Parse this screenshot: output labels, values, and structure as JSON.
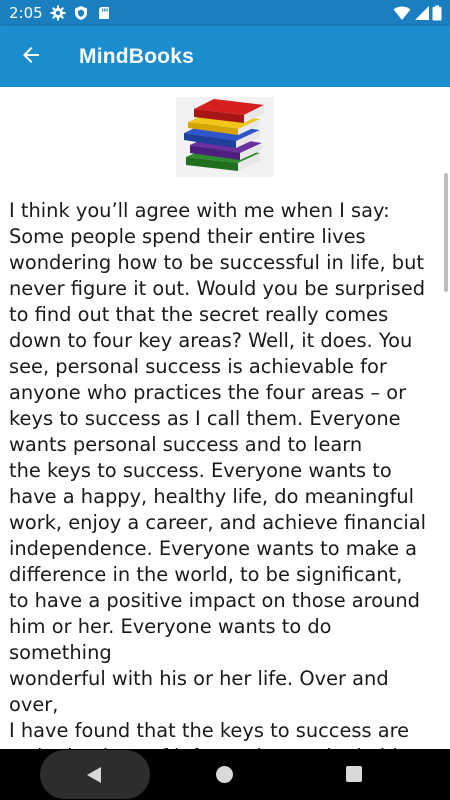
{
  "status_bar": {
    "time": "2:05",
    "left_icons": [
      "gear-icon",
      "shield-icon",
      "sd-card-icon"
    ],
    "right_icons": [
      "wifi-icon",
      "cellular-signal-icon",
      "battery-icon"
    ]
  },
  "app_bar": {
    "back_icon": "arrow-back-icon",
    "title": "MindBooks",
    "color": "#1b8ccd"
  },
  "content": {
    "image": "stack-of-books",
    "text": "I think you’ll agree with me when I say:\nSome people spend their entire lives\nwondering how to be successful in life, but\nnever figure it out. Would you be surprised\nto find out that the secret really comes\ndown to four key areas? Well, it does. You\nsee, personal success is achievable for\nanyone who practices the four areas – or\nkeys to success as I call them. Everyone\nwants personal success and to learn\nthe keys to success. Everyone wants to\nhave a happy, healthy life, do meaningful\nwork, enjoy a career, and achieve financial\nindependence. Everyone wants to make a\ndifference in the world, to be significant,\nto have a positive impact on those around\nhim or her. Everyone wants to do something\nwonderful with his or her life. Over and over,\nI have found that the keys to success are\na single piece of information, a single idea\nat the right time, that can change your life\nin the right situation. I have also learned"
  },
  "nav_bar": {
    "back_icon": "triangle-back-icon",
    "home_icon": "circle-home-icon",
    "recents_icon": "square-recents-icon"
  }
}
